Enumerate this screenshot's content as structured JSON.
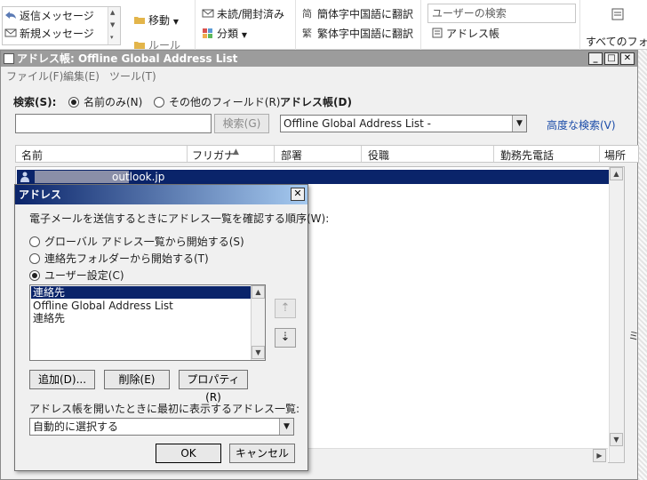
{
  "ribbon": {
    "reply_message": "返信メッセージ",
    "new_message": "新規メッセージ",
    "move": "移動",
    "move_partial": "ルール",
    "unread_read": "未読/開封済み",
    "categorize": "分類",
    "to_simplified": "簡体字中国語に翻訳",
    "to_traditional": "繁体字中国語に翻訳",
    "search_people_placeholder": "ユーザーの検索",
    "address_book": "アドレス帳",
    "all_folders": "すべてのフォル"
  },
  "address_book_window": {
    "title": "アドレス帳: Offline Global Address List",
    "menu": [
      "ファイル(F)",
      "編集(E)",
      "ツール(T)"
    ],
    "search_label": "検索(S):",
    "radio_name_only": "名前のみ(N)",
    "radio_other_fields": "その他のフィールド(R)",
    "address_book_label": "アドレス帳(D)",
    "search_value": "",
    "search_button": "検索(G)",
    "address_book_selected": "Offline Global Address List -",
    "advanced_find": "高度な検索(V)",
    "columns": [
      "名前",
      "フリガナ",
      "部署",
      "役職",
      "勤務先電話",
      "場所"
    ],
    "selected_row_text": "outlook.jp",
    "side_char": "ミ"
  },
  "addressing_dialog": {
    "title": "アドレス",
    "prompt": "電子メールを送信するときにアドレス一覧を確認する順序(W):",
    "option_gal": "グローバル アドレス一覧から開始する(S)",
    "option_contacts": "連絡先フォルダーから開始する(T)",
    "option_custom": "ユーザー設定(C)",
    "list_items": [
      "連絡先",
      "Offline Global Address List",
      "連絡先"
    ],
    "move_up": "⇡",
    "move_down": "⇣",
    "add_button": "追加(D)...",
    "remove_button": "削除(E)",
    "properties_button": "プロパティ(R)",
    "startup_label": "アドレス帳を開いたときに最初に表示するアドレス一覧:",
    "startup_value": "自動的に選択する",
    "ok_button": "OK",
    "cancel_button": "キャンセル"
  },
  "colors": {
    "selection": "#0a246a",
    "dialog_title_start": "#0a246a",
    "dialog_title_end": "#a6caf0",
    "window_title": "#9c9c9c",
    "link": "#1a4ba8"
  }
}
